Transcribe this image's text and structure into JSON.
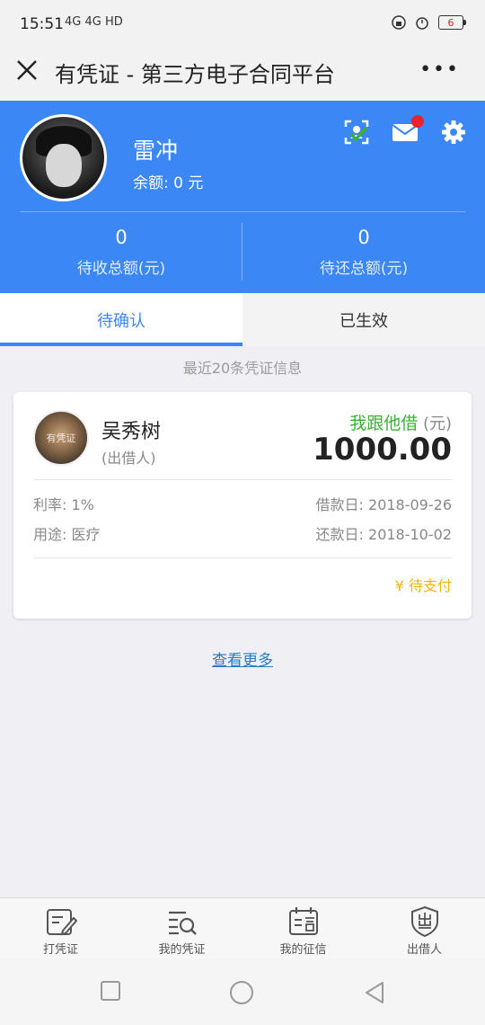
{
  "status_bar": {
    "time": "15:51",
    "network": "4G 4G HD",
    "battery": "6"
  },
  "title_bar": {
    "title": "有凭证 - 第三方电子合同平台",
    "more": "•••"
  },
  "profile": {
    "username": "雷冲",
    "balance": "余额: 0 元",
    "stats": [
      {
        "value": "0",
        "label": "待收总额(元)"
      },
      {
        "value": "0",
        "label": "待还总额(元)"
      }
    ],
    "header_icons": [
      "verify-check-icon",
      "mail-icon",
      "gear-icon"
    ],
    "accent": "#3b87f6"
  },
  "tabs": [
    {
      "label": "待确认",
      "active": true
    },
    {
      "label": "已生效",
      "active": false
    }
  ],
  "hint": "最近20条凭证信息",
  "card": {
    "avatar_text": "有凭证",
    "name": "吴秀树",
    "role": "(出借人)",
    "loan_type": "我跟他借",
    "unit": "(元)",
    "amount": "1000.00",
    "rate": "利率:  1%",
    "purpose": "用途:  医疗",
    "borrow_date": "借款日:  2018-09-26",
    "repay_date": "还款日:  2018-10-02",
    "pay_status": "¥ 待支付"
  },
  "more_link": "查看更多",
  "bottom_nav": [
    {
      "label": "打凭证",
      "icon": "edit-note-icon"
    },
    {
      "label": "我的凭证",
      "icon": "list-search-icon"
    },
    {
      "label": "我的征信",
      "icon": "credit-calendar-icon"
    },
    {
      "label": "出借人",
      "icon": "lender-shield-icon"
    }
  ]
}
